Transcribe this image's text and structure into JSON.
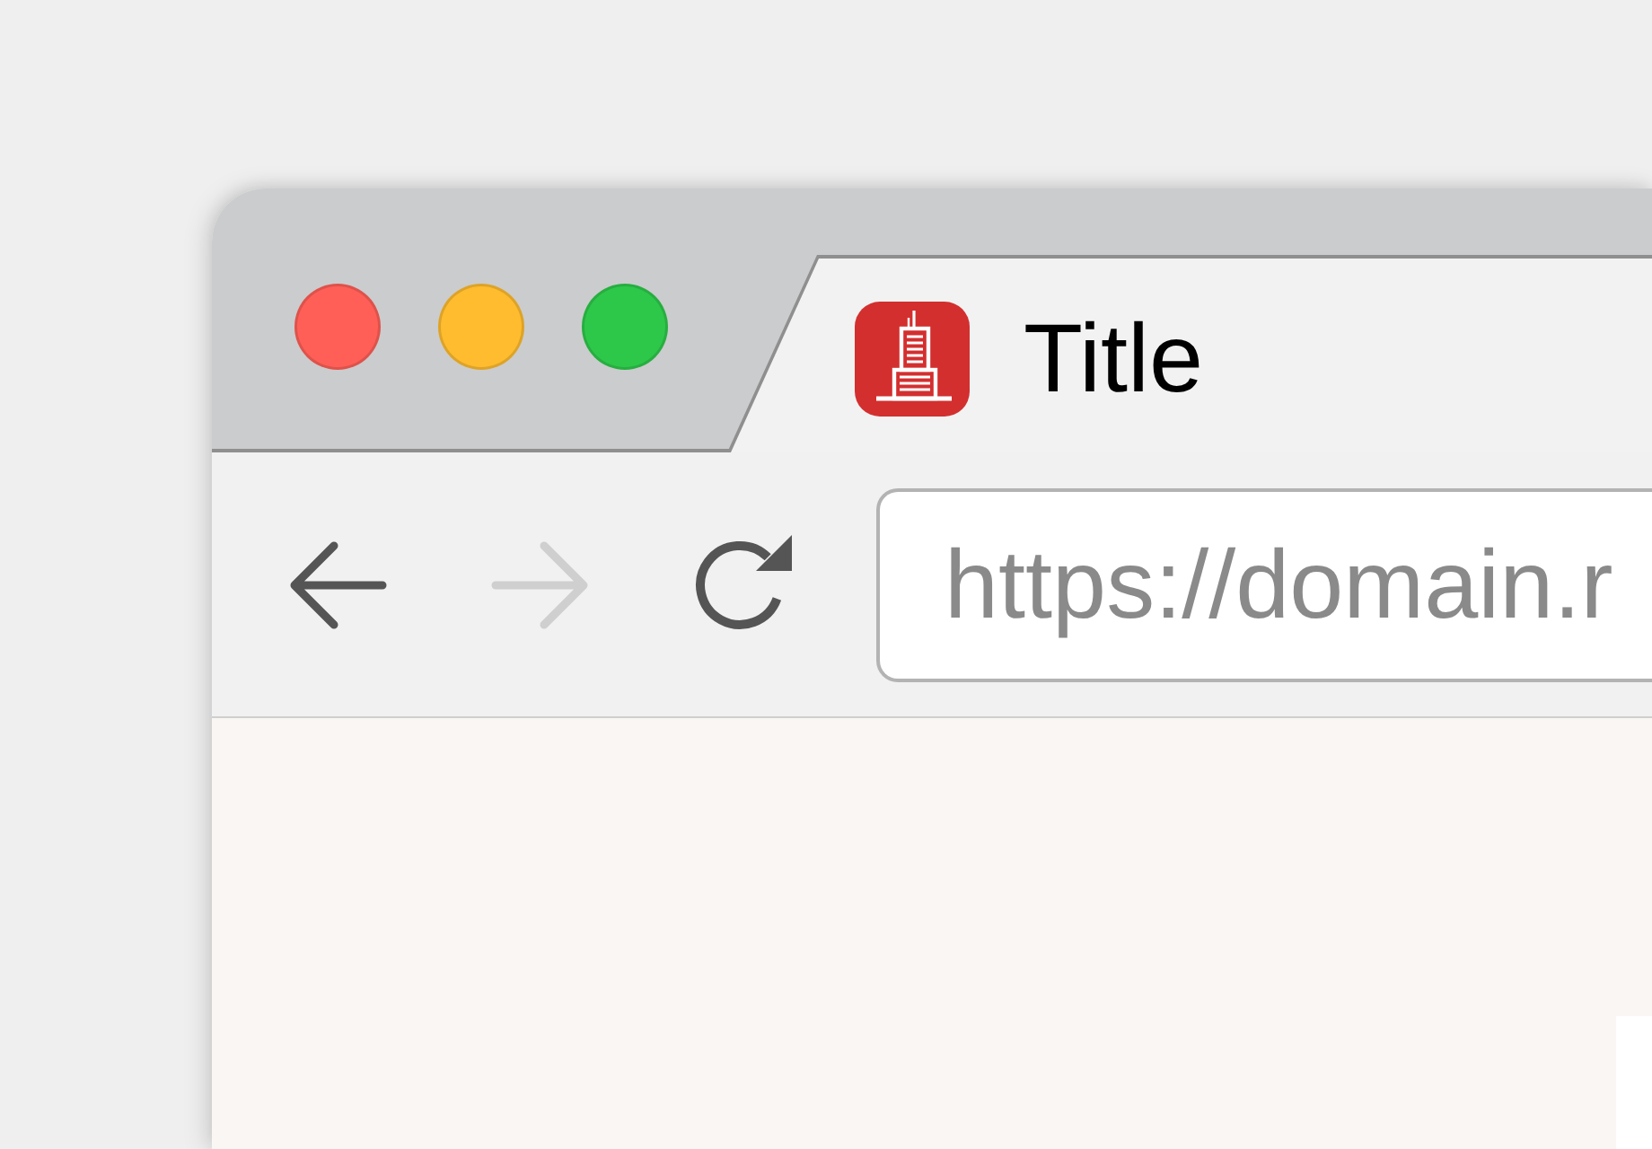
{
  "window_controls": [
    {
      "color": "#ff5f57"
    },
    {
      "color": "#febc2e"
    },
    {
      "color": "#2dc84a"
    }
  ],
  "tabs": [
    {
      "title": "Title",
      "selected": true
    }
  ],
  "toolbar": {
    "nav_buttons": [
      {
        "kind": "back",
        "disabled": false
      },
      {
        "kind": "forward",
        "disabled": true
      },
      {
        "kind": "reload",
        "disabled": false
      }
    ],
    "address_bar": {
      "value": "https://domain.r"
    }
  }
}
